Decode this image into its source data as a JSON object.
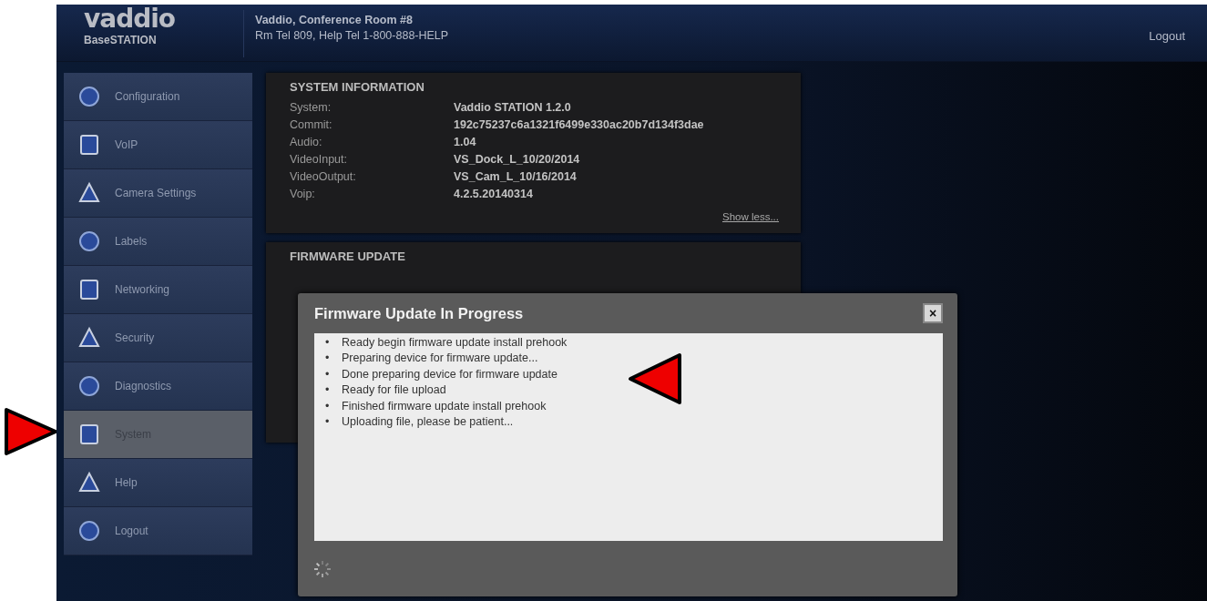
{
  "header": {
    "logo": "vaddio",
    "product": "BaseSTATION",
    "room": "Vaddio, Conference Room #8",
    "phones": "Rm Tel 809, Help Tel 1-800-888-HELP",
    "logout": "Logout"
  },
  "sidebar": {
    "items": [
      {
        "label": "Configuration",
        "selected": false
      },
      {
        "label": "VoIP",
        "selected": false
      },
      {
        "label": "Camera Settings",
        "selected": false
      },
      {
        "label": "Labels",
        "selected": false
      },
      {
        "label": "Networking",
        "selected": false
      },
      {
        "label": "Security",
        "selected": false
      },
      {
        "label": "Diagnostics",
        "selected": false
      },
      {
        "label": "System",
        "selected": true
      },
      {
        "label": "Help",
        "selected": false
      },
      {
        "label": "Logout",
        "selected": false
      }
    ]
  },
  "system_information": {
    "title": "SYSTEM INFORMATION",
    "rows": [
      {
        "label": "System:",
        "value": "Vaddio STATION 1.2.0"
      },
      {
        "label": "Commit:",
        "value": "192c75237c6a1321f6499e330ac20b7d134f3dae"
      },
      {
        "label": "Audio:",
        "value": "1.04"
      },
      {
        "label": "VideoInput:",
        "value": "VS_Dock_L_10/20/2014"
      },
      {
        "label": "VideoOutput:",
        "value": "VS_Cam_L_10/16/2014"
      },
      {
        "label": "Voip:",
        "value": "4.2.5.20140314"
      }
    ],
    "link": "Show less..."
  },
  "firmware_update": {
    "title": "FIRMWARE UPDATE"
  },
  "dialog": {
    "title": "Firmware Update In Progress",
    "close": "×",
    "messages": [
      {
        "bullet": "•",
        "text": "Ready begin firmware update install prehook"
      },
      {
        "bullet": "•",
        "text": "Preparing device for firmware update..."
      },
      {
        "bullet": "•",
        "text": "Done preparing device for firmware update"
      },
      {
        "bullet": "•",
        "text": "Ready for file upload"
      },
      {
        "bullet": "•",
        "text": "Finished firmware update install prehook"
      },
      {
        "bullet": "•",
        "text": "Uploading file, please be patient..."
      }
    ]
  }
}
